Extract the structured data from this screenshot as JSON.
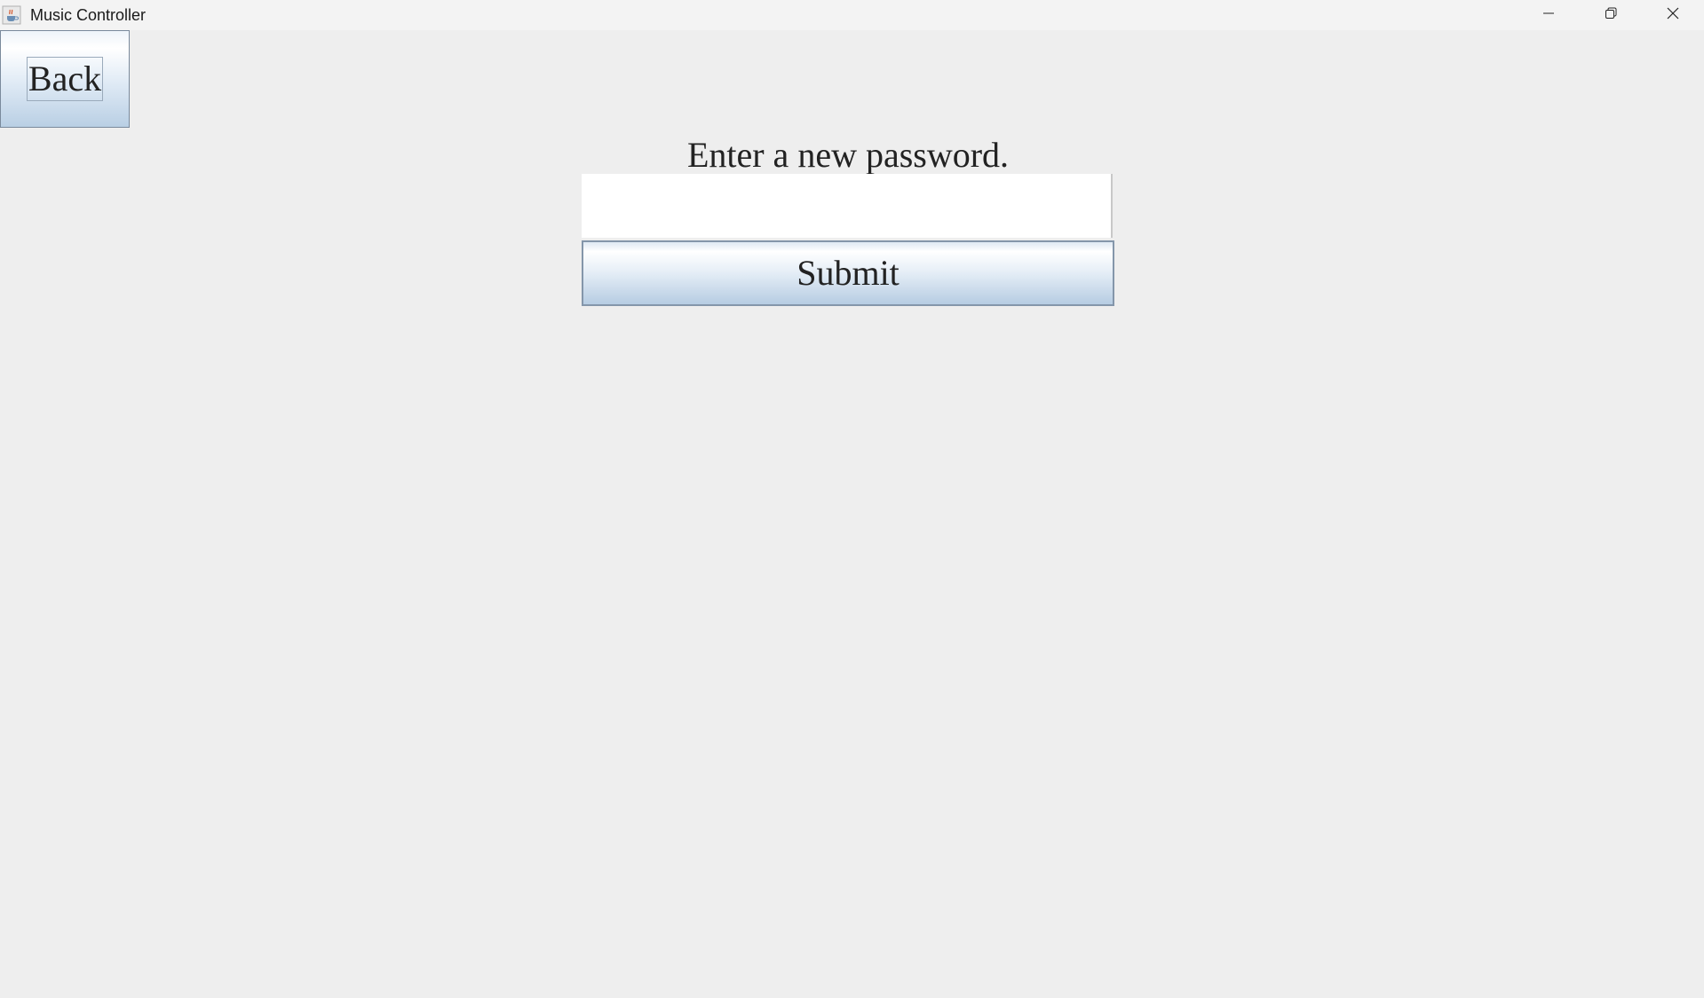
{
  "window": {
    "title": "Music Controller",
    "icon": "java-cup-icon"
  },
  "controls": {
    "minimize_icon": "minimize-icon",
    "maximize_icon": "restore-icon",
    "close_icon": "close-icon"
  },
  "main": {
    "back_label": "Back",
    "prompt": "Enter a new password.",
    "password_value": "",
    "submit_label": "Submit"
  },
  "colors": {
    "background": "#eeeeee",
    "button_gradient_top": "#ffffff",
    "button_gradient_bottom": "#b6cce2",
    "button_border": "#8496aa"
  }
}
